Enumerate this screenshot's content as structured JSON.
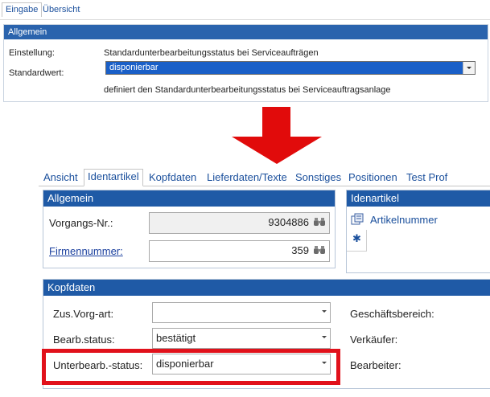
{
  "top": {
    "tabs": [
      {
        "label": "Eingabe",
        "active": true
      },
      {
        "label": "Übersicht",
        "active": false
      }
    ],
    "section_title": "Allgemein",
    "setting_label": "Einstellung:",
    "setting_value": "Standardunterbearbeitungsstatus bei Serviceaufträgen",
    "default_label": "Standardwert:",
    "default_value": "disponierbar",
    "description": "definiert den Standardunterbearbeitungsstatus bei Serviceauftragsanlage"
  },
  "colors": {
    "arrow": "#e10b0b",
    "header": "#1f5aa6",
    "highlight": "#e1111b",
    "selection": "#1a5fc7"
  },
  "bottom": {
    "tabs": [
      "Ansicht",
      "Identartikel",
      "Kopfdaten",
      "Lieferdaten/Texte",
      "Sonstiges",
      "Positionen",
      "Test Prof"
    ],
    "active_tab": "Identartikel",
    "allgemein": {
      "title": "Allgemein",
      "vorgangs_label": "Vorgangs-Nr.:",
      "vorgangs_value": "9304886",
      "firmen_label": "Firmennummer:",
      "firmen_value": "359"
    },
    "idenartikel": {
      "title": "Idenartikel",
      "column": "Artikelnummer",
      "new_row_marker": "✱"
    },
    "kopfdaten": {
      "title": "Kopfdaten",
      "zus_label": "Zus.Vorg-art:",
      "zus_value": "",
      "bearb_label": "Bearb.status:",
      "bearb_value": "bestätigt",
      "unter_label": "Unterbearb.-status:",
      "unter_value": "disponierbar",
      "geschaeft_label": "Geschäftsbereich:",
      "verkaeufer_label": "Verkäufer:",
      "bearbeiter_label": "Bearbeiter:"
    }
  }
}
